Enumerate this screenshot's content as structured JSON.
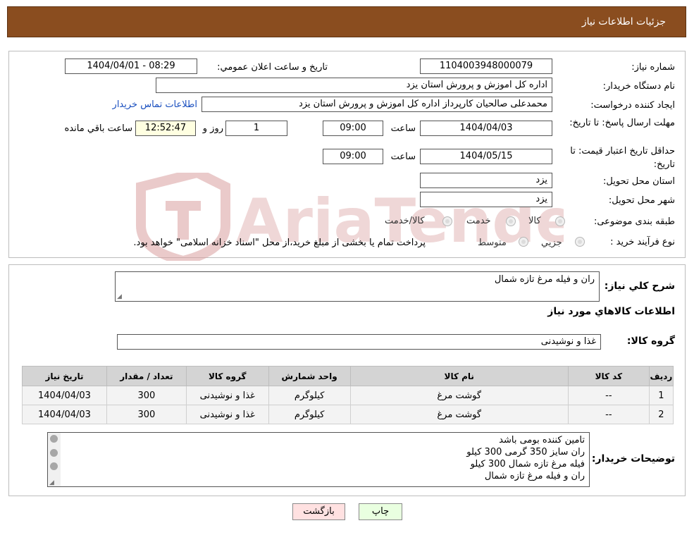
{
  "header": {
    "title": "جزئيات اطلاعات نياز"
  },
  "fields": {
    "need_number_label": "شماره نياز:",
    "need_number": "1104003948000079",
    "announce_label": "تاريخ و ساعت اعلان عمومي:",
    "announce_value": "1404/04/01 - 08:29",
    "buyer_label": "نام دستگاه خريدار:",
    "buyer_value": "اداره کل اموزش و پرورش استان يزد",
    "creator_label": "ايجاد کننده درخواست:",
    "creator_value": "محمدعلی صالحیان کارپرداز اداره کل اموزش و پرورش استان يزد",
    "contact_link": "اطلاعات تماس خريدار",
    "deadline_label": "مهلت ارسال پاسخ: تا تاريخ:",
    "deadline_date": "1404/04/03",
    "time_label": "ساعت",
    "deadline_time": "09:00",
    "days_value": "1",
    "days_label": "روز و",
    "remaining_time": "12:52:47",
    "remaining_label": "ساعت باقي مانده",
    "validity_label": "حداقل تاريخ اعتبار قيمت: تا تاريخ:",
    "validity_date": "1404/05/15",
    "validity_time": "09:00",
    "province_label": "استان محل تحويل:",
    "province_value": "يزد",
    "city_label": "شهر محل تحويل:",
    "city_value": "يزد",
    "category_label": "طبقه بندی موضوعی:",
    "category_options": [
      "کالا",
      "خدمت",
      "کالا/خدمت"
    ],
    "process_label": "نوع فرآيند خريد :",
    "process_options": [
      "جزيي",
      "متوسط"
    ],
    "process_note": "پرداخت تمام يا بخشی از مبلغ خريد،از محل \"اسناد خزانه اسلامی\" خواهد بود."
  },
  "summary": {
    "label": "شرح کلي نياز:",
    "value": "ران و فیله مرغ تازه شمال",
    "goods_info_title": "اطلاعات کالاهاي مورد نياز",
    "group_label": "گروه کالا:",
    "group_value": "غذا و نوشيدنی"
  },
  "table": {
    "headers": [
      "رديف",
      "کد کالا",
      "نام کالا",
      "واحد شمارش",
      "گروه کالا",
      "تعداد / مقدار",
      "تاريخ نياز"
    ],
    "rows": [
      [
        "1",
        "--",
        "گوشت مرغ",
        "کيلوگرم",
        "غذا و نوشيدنی",
        "300",
        "1404/04/03"
      ],
      [
        "2",
        "--",
        "گوشت مرغ",
        "کيلوگرم",
        "غذا و نوشيدنی",
        "300",
        "1404/04/03"
      ]
    ]
  },
  "buyer_notes": {
    "label": "توضيحات خريدار:",
    "lines": [
      "تامین کننده بومی باشد",
      "ران سایز 350 گرمی 300 کیلو",
      "فیله مرغ تازه شمال 300 کیلو",
      "ران و فیله مرغ تازه شمال"
    ]
  },
  "buttons": {
    "print": "چاپ",
    "back": "بازگشت"
  },
  "colors": {
    "header_bg": "#8a4d1f",
    "link": "#1a4fbf",
    "back_button_bg": "#ffe1e1",
    "print_button_bg": "#e9ffe0",
    "watermark": "#d9a0a0"
  },
  "watermark": {
    "text": "AriaTender.neT"
  }
}
